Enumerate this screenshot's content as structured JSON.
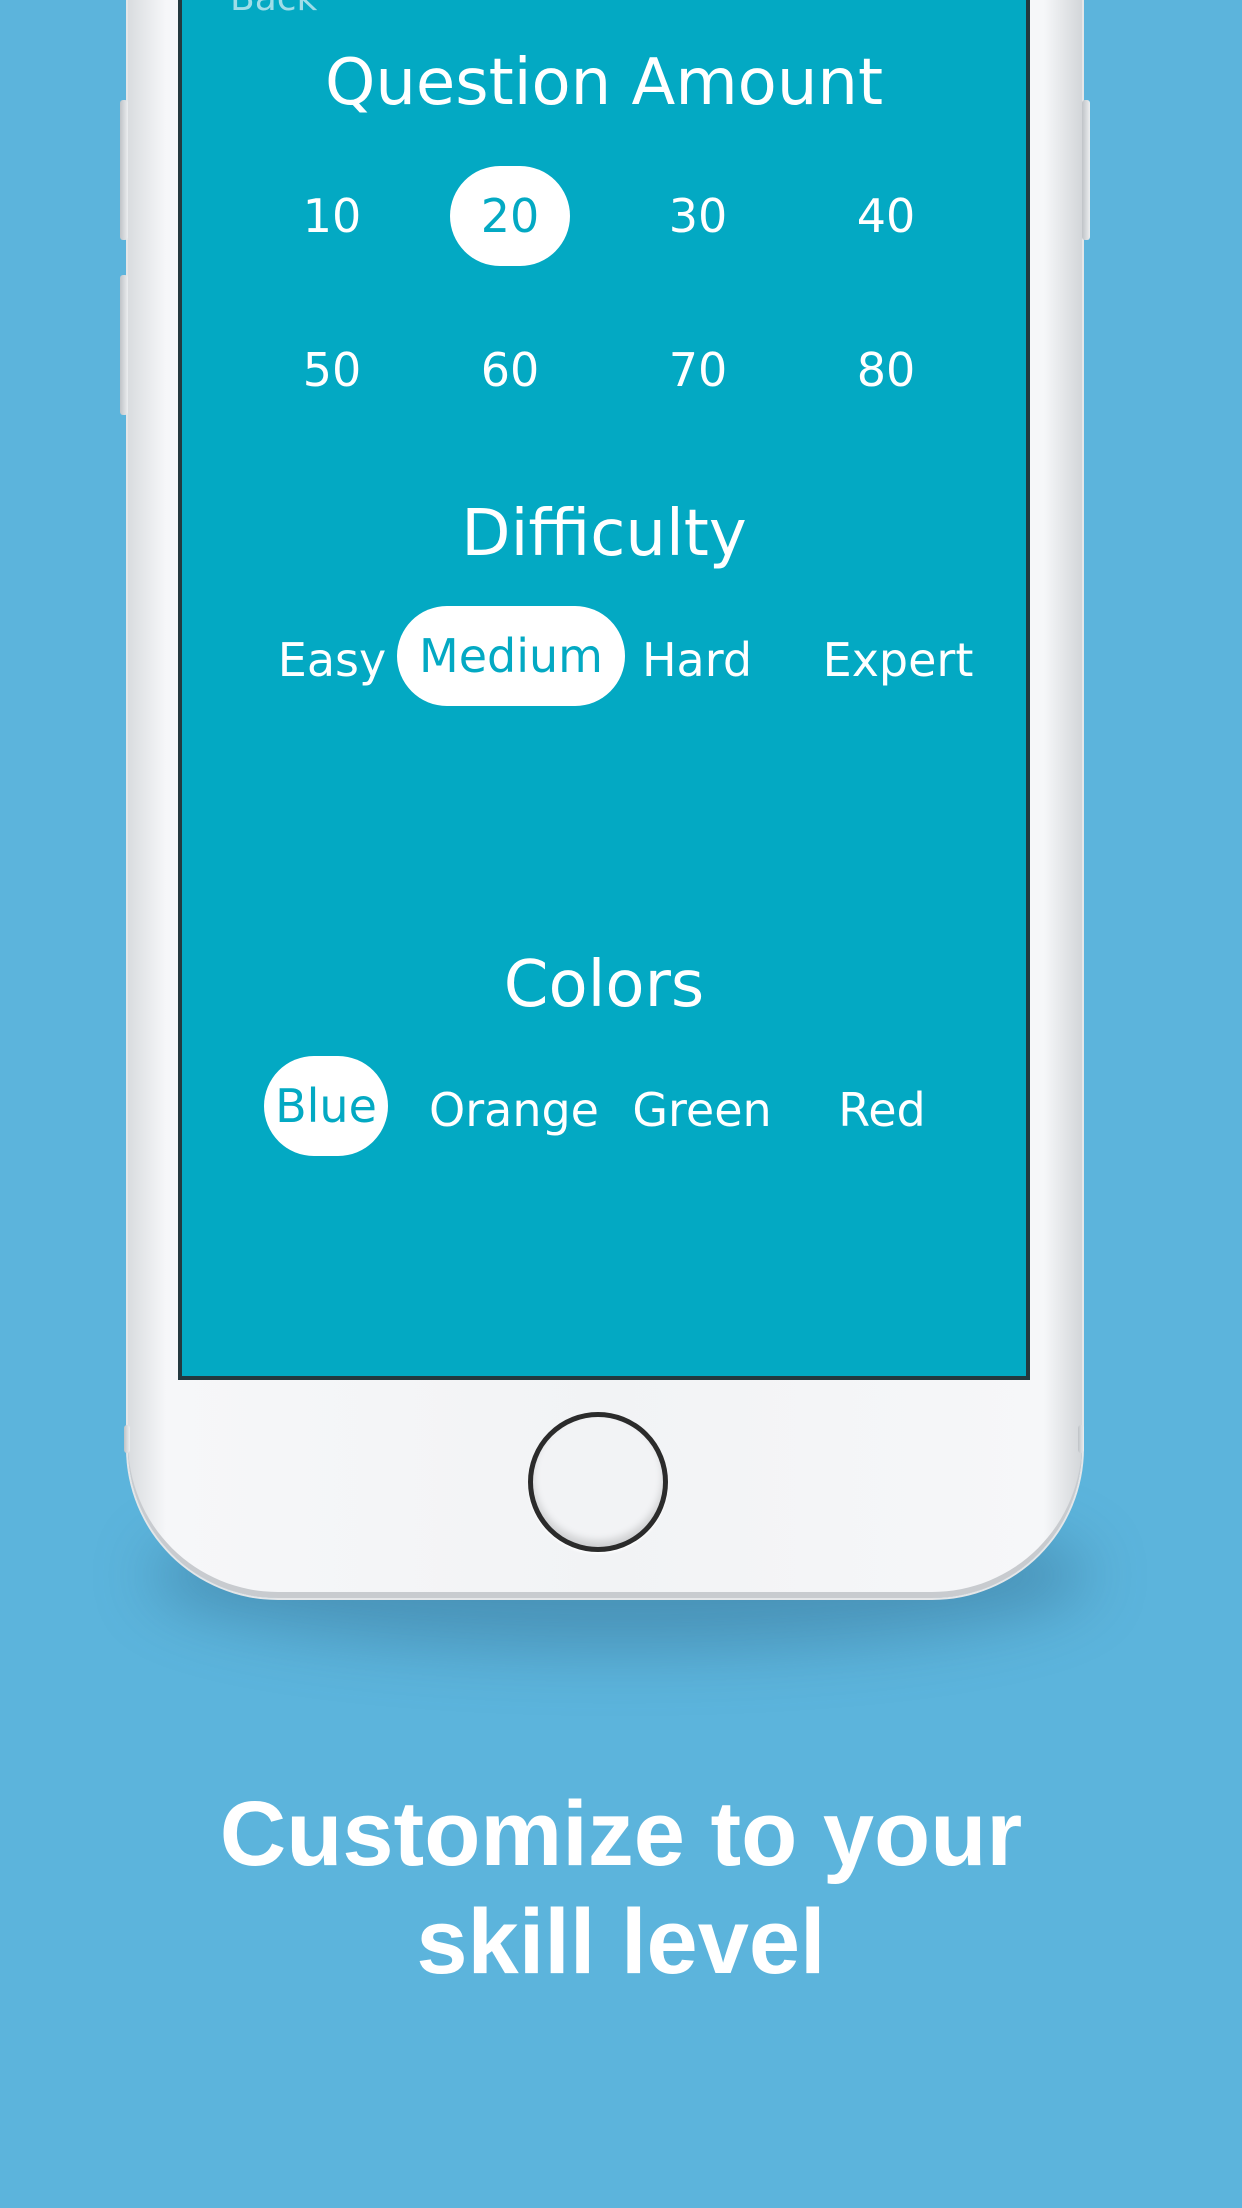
{
  "header": {
    "back_label": "Back"
  },
  "question_amount": {
    "title": "Question Amount",
    "options": [
      "10",
      "20",
      "30",
      "40",
      "50",
      "60",
      "70",
      "80"
    ],
    "selected": "20"
  },
  "difficulty": {
    "title": "Difficulty",
    "options": [
      "Easy",
      "Medium",
      "Hard",
      "Expert"
    ],
    "selected": "Medium"
  },
  "colors": {
    "title": "Colors",
    "options": [
      "Blue",
      "Orange",
      "Green",
      "Red"
    ],
    "selected": "Blue"
  },
  "caption": {
    "line1": "Customize to your",
    "line2": "skill level"
  },
  "theme": {
    "background": "#5cb4dc",
    "screen": "#03a9c3",
    "selected_pill": "#ffffff"
  }
}
